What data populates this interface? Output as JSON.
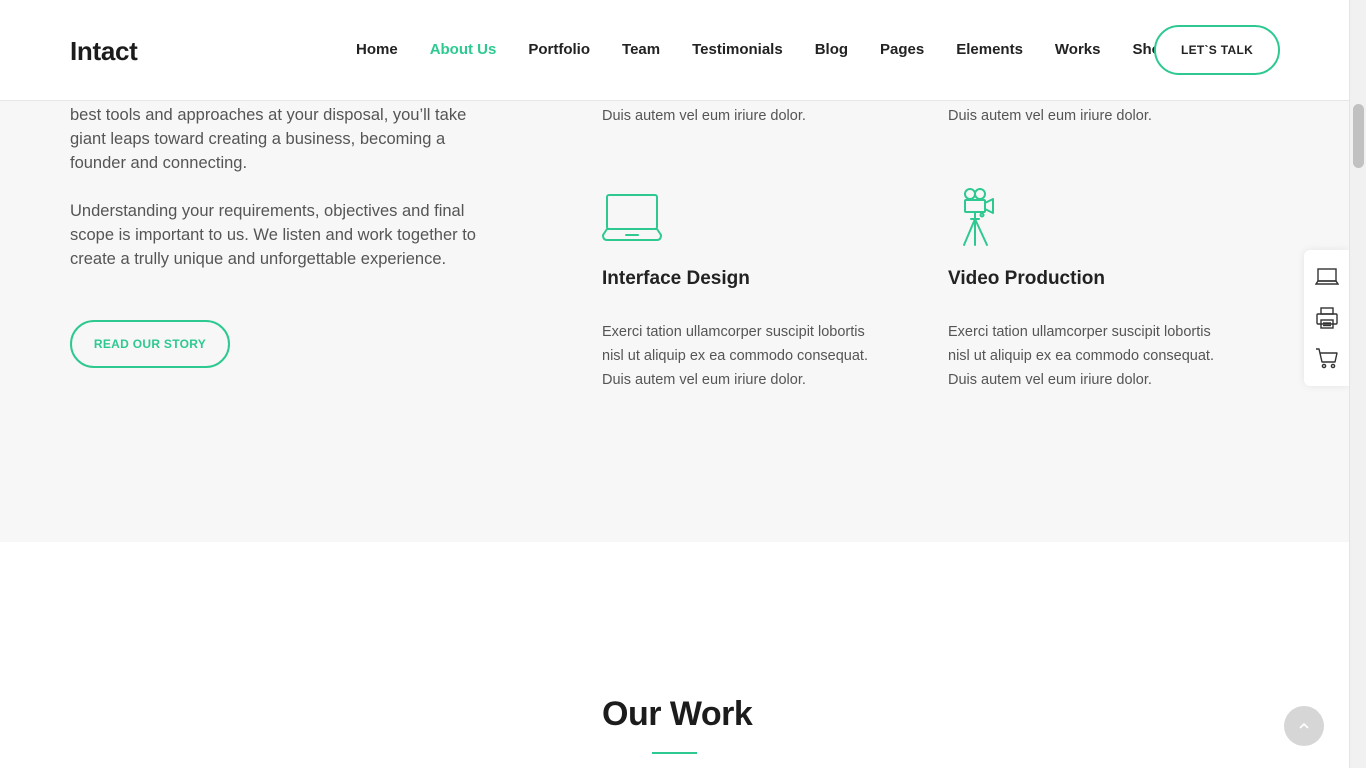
{
  "header": {
    "logo": "Intact",
    "nav": [
      {
        "label": "Home",
        "active": false
      },
      {
        "label": "About Us",
        "active": true
      },
      {
        "label": "Portfolio",
        "active": false
      },
      {
        "label": "Team",
        "active": false
      },
      {
        "label": "Testimonials",
        "active": false
      },
      {
        "label": "Blog",
        "active": false
      },
      {
        "label": "Pages",
        "active": false
      },
      {
        "label": "Elements",
        "active": false
      },
      {
        "label": "Works",
        "active": false
      },
      {
        "label": "Shop",
        "active": false
      }
    ],
    "cta_label": "LET`S TALK"
  },
  "intro": {
    "paragraph1": "best tools and approaches at your disposal, you’ll take giant leaps toward creating a business, becoming a founder and connecting.",
    "paragraph2": "Understanding your requirements, objectives and final scope is important to us. We listen and work together to create a trully unique and unforgettable experience.",
    "button_label": "READ OUR STORY"
  },
  "services": {
    "top_left_tail": "Duis autem vel eum iriure dolor.",
    "top_right_tail": "Duis autem vel eum iriure dolor.",
    "items": [
      {
        "title": "Interface Design",
        "icon": "laptop-icon",
        "text": "Exerci tation ullamcorper suscipit lobortis nisl ut aliquip ex ea commodo consequat. Duis autem vel eum iriure dolor."
      },
      {
        "title": "Video Production",
        "icon": "video-camera-tripod-icon",
        "text": "Exerci tation ullamcorper suscipit lobortis nisl ut aliquip ex ea commodo consequat. Duis autem vel eum iriure dolor."
      }
    ]
  },
  "float_bar": {
    "icons": [
      "laptop-icon",
      "printer-icon",
      "cart-icon"
    ]
  },
  "work": {
    "title": "Our Work"
  },
  "colors": {
    "accent": "#2ec990",
    "section_gray": "#f7f7f7",
    "text_dark": "#222222",
    "text_body": "#555555"
  }
}
